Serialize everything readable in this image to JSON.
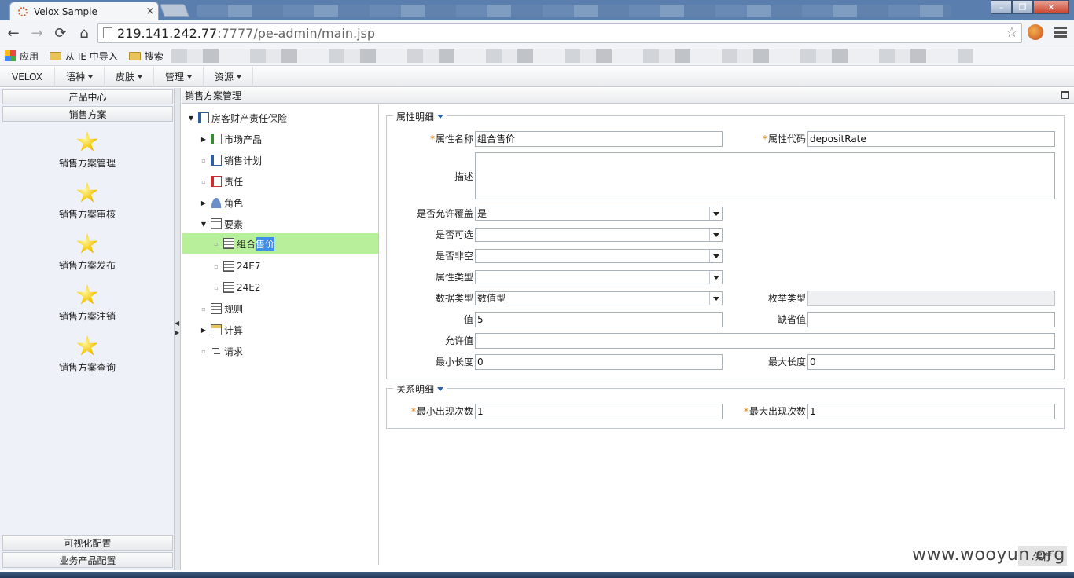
{
  "browser": {
    "tab_title": "Velox Sample",
    "tab_close": "×",
    "url_host": "219.141.242.77",
    "url_rest": ":7777/pe-admin/main.jsp",
    "bookmarks": [
      "应用",
      "从 IE 中导入",
      "搜索"
    ]
  },
  "menu": {
    "brand": "VELOX",
    "items": [
      "语种",
      "皮肤",
      "管理",
      "资源"
    ]
  },
  "sidebar": {
    "sections": [
      "产品中心",
      "销售方案"
    ],
    "items": [
      "销售方案管理",
      "销售方案审核",
      "销售方案发布",
      "销售方案注销",
      "销售方案查询"
    ],
    "bottom_sections": [
      "可视化配置",
      "业务产品配置"
    ]
  },
  "panel": {
    "title": "销售方案管理"
  },
  "tree": {
    "root": "房客财产责任保险",
    "n1": "市场产品",
    "n2": "销售计划",
    "n3": "责任",
    "n4": "角色",
    "n5": "要素",
    "n5a_pre": "组合",
    "n5a_hl": "售价",
    "n5b": "24E7",
    "n5c": "24E2",
    "n6": "规则",
    "n7": "计算",
    "n8": "请求"
  },
  "attr": {
    "legend": "属性明细",
    "name_label": "属性名称",
    "name_value": "组合售价",
    "code_label": "属性代码",
    "code_value": "depositRate",
    "desc_label": "描述",
    "override_label": "是否允许覆盖",
    "override_value": "是",
    "optional_label": "是否可选",
    "optional_value": "",
    "notnull_label": "是否非空",
    "notnull_value": "",
    "type_label": "属性类型",
    "type_value": "",
    "datatype_label": "数据类型",
    "datatype_value": "数值型",
    "enum_label": "枚举类型",
    "enum_value": "",
    "value_label": "值",
    "value_value": "5",
    "default_label": "缺省值",
    "default_value": "",
    "allowed_label": "允许值",
    "allowed_value": "",
    "minlen_label": "最小长度",
    "minlen_value": "0",
    "maxlen_label": "最大长度",
    "maxlen_value": "0"
  },
  "rel": {
    "legend": "关系明细",
    "min_label": "最小出现次数",
    "min_value": "1",
    "max_label": "最大出现次数",
    "max_value": "1"
  },
  "watermark": {
    "site": "www.wooyun.org",
    "box": "保存"
  }
}
